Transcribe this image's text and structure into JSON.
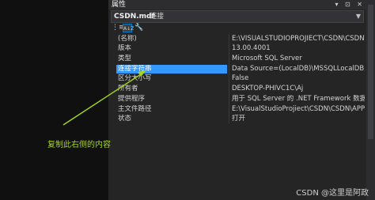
{
  "panel": {
    "title": "属性",
    "window_buttons": "▾ ⊡ ✕",
    "object_name": "CSDN.mdf",
    "object_type": "连接",
    "toolbar_icons": [
      "property-grid-icon",
      "sort-icon",
      "settings-wrench-icon"
    ]
  },
  "properties": [
    {
      "key": "(名称)",
      "value": "E:\\VISUALSTUDIOPROJIECT\\CSDN\\CSDN\\A"
    },
    {
      "key": "版本",
      "value": "13.00.4001"
    },
    {
      "key": "类型",
      "value": "Microsoft SQL Server"
    },
    {
      "key": "连接字符串",
      "value": "Data Source=(LocalDB)\\MSSQLLocalDB;At"
    },
    {
      "key": "区分大小写",
      "value": "False"
    },
    {
      "key": "所有者",
      "value": "DESKTOP-PHIVC1C\\Aj"
    },
    {
      "key": "提供程序",
      "value": "用于 SQL Server 的 .NET Framework 数据提"
    },
    {
      "key": "主文件路径",
      "value": "E:\\VisualStudioProjiect\\CSDN\\CSDN\\APP_"
    },
    {
      "key": "状态",
      "value": "打开"
    }
  ],
  "annotation": {
    "text": "复制此右侧的内容"
  },
  "watermark": {
    "text": "CSDN @这里是阿政"
  },
  "colors": {
    "selection": "#3399ff",
    "annotation": "#a6d61a",
    "accent": "#007acc"
  }
}
